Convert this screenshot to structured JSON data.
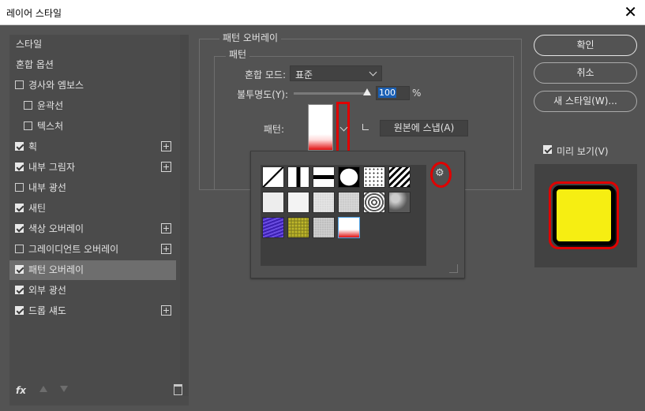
{
  "window": {
    "title": "레이어 스타일",
    "close_label": "✕"
  },
  "sidebar": {
    "items": [
      {
        "label": "스타일",
        "checkbox": false,
        "checked": false,
        "plus": false,
        "indent": 0
      },
      {
        "label": "혼합 옵션",
        "checkbox": false,
        "checked": false,
        "plus": false,
        "indent": 0
      },
      {
        "label": "경사와 엠보스",
        "checkbox": true,
        "checked": false,
        "plus": false,
        "indent": 0
      },
      {
        "label": "윤곽선",
        "checkbox": true,
        "checked": false,
        "plus": false,
        "indent": 1
      },
      {
        "label": "텍스처",
        "checkbox": true,
        "checked": false,
        "plus": false,
        "indent": 1
      },
      {
        "label": "획",
        "checkbox": true,
        "checked": true,
        "plus": true,
        "indent": 0
      },
      {
        "label": "내부 그림자",
        "checkbox": true,
        "checked": true,
        "plus": true,
        "indent": 0
      },
      {
        "label": "내부 광선",
        "checkbox": true,
        "checked": false,
        "plus": false,
        "indent": 0
      },
      {
        "label": "새틴",
        "checkbox": true,
        "checked": true,
        "plus": false,
        "indent": 0
      },
      {
        "label": "색상 오버레이",
        "checkbox": true,
        "checked": true,
        "plus": true,
        "indent": 0
      },
      {
        "label": "그레이디언트 오버레이",
        "checkbox": true,
        "checked": false,
        "plus": true,
        "indent": 0
      },
      {
        "label": "패턴 오버레이",
        "checkbox": true,
        "checked": true,
        "plus": false,
        "indent": 0,
        "selected": true
      },
      {
        "label": "외부 광선",
        "checkbox": true,
        "checked": true,
        "plus": false,
        "indent": 0
      },
      {
        "label": "드롭 섀도",
        "checkbox": true,
        "checked": true,
        "plus": true,
        "indent": 0
      }
    ],
    "bottom": {
      "fx_label": "fx"
    }
  },
  "panel": {
    "group_title": "패턴 오버레이",
    "subgroup_title": "패턴",
    "blend_mode_label": "혼합 모드:",
    "blend_mode_value": "표준",
    "opacity_label": "불투명도(Y):",
    "opacity_value": "100",
    "opacity_unit": "%",
    "opacity_fraction": 1.0,
    "pattern_label": "패턴:",
    "snap_button": "원본에 스냅(A)"
  },
  "pattern_picker": {
    "patterns": [
      {
        "name": "diagonal-line",
        "colors": [
          "#ffffff",
          "#000000"
        ]
      },
      {
        "name": "vertical-bar",
        "colors": [
          "#ffffff",
          "#000000"
        ]
      },
      {
        "name": "horizontal-bar",
        "colors": [
          "#ffffff",
          "#000000"
        ]
      },
      {
        "name": "black-frame",
        "colors": [
          "#ffffff",
          "#000000"
        ]
      },
      {
        "name": "dots",
        "colors": [
          "#ffffff",
          "#222222"
        ]
      },
      {
        "name": "diagonal-stripes",
        "colors": [
          "#ffffff",
          "#000000"
        ]
      },
      {
        "name": "light-gray-1",
        "colors": [
          "#ededed",
          "#ededed"
        ]
      },
      {
        "name": "light-gray-2",
        "colors": [
          "#f3f3f3",
          "#f3f3f3"
        ]
      },
      {
        "name": "gray-noise-1",
        "colors": [
          "#e6e6e6",
          "#cfcfcf"
        ]
      },
      {
        "name": "gray-noise-2",
        "colors": [
          "#d9d9d9",
          "#bdbdbd"
        ]
      },
      {
        "name": "concentric-squares",
        "colors": [
          "#ffffff",
          "#555555"
        ]
      },
      {
        "name": "stone-texture",
        "colors": [
          "#cccccc",
          "#5a5a5a"
        ]
      },
      {
        "name": "purple-water",
        "colors": [
          "#3b1fb0",
          "#6a4de0"
        ]
      },
      {
        "name": "yellow-texture",
        "colors": [
          "#c2bb2a",
          "#8a8520"
        ]
      },
      {
        "name": "gray-grain",
        "colors": [
          "#d2d2d2",
          "#a9a9a9"
        ]
      },
      {
        "name": "white-red-gradient",
        "colors": [
          "#ffffff",
          "#e01010"
        ],
        "selected": true
      }
    ]
  },
  "buttons": {
    "ok": "확인",
    "cancel": "취소",
    "new_style": "새 스타일(W)...",
    "preview_label": "미리 보기(V)",
    "preview_checked": true
  },
  "colors": {
    "preview_fill": "#f6ee12",
    "highlight_red": "#e00000",
    "selection_blue": "#1a5fb4"
  }
}
